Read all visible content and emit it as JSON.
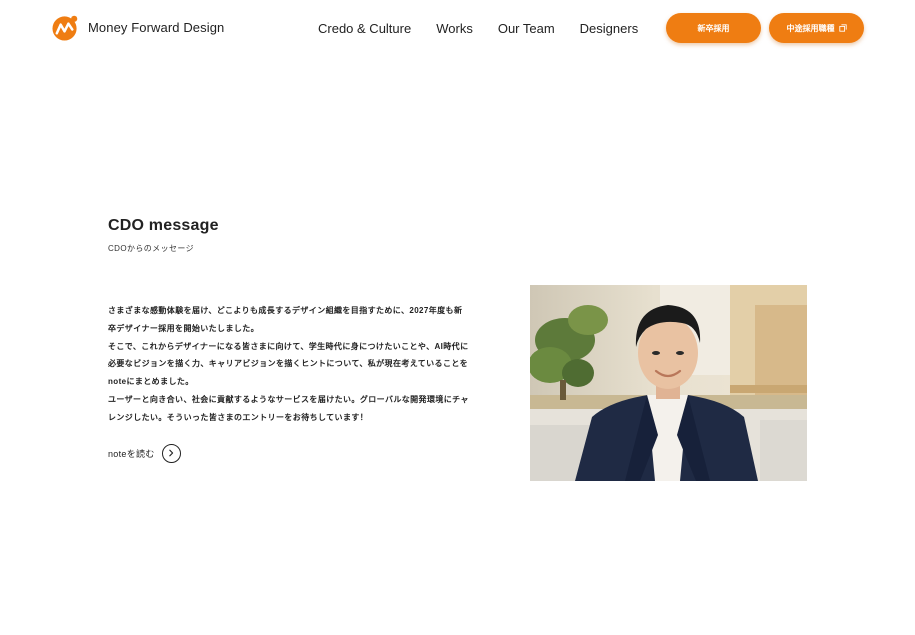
{
  "header": {
    "brand_name": "Money Forward Design",
    "nav": [
      {
        "label": "Credo & Culture"
      },
      {
        "label": "Works"
      },
      {
        "label": "Our Team"
      },
      {
        "label": "Designers"
      }
    ],
    "buttons": {
      "new_grad": "新卒採用",
      "mid_career": "中途採用職種"
    }
  },
  "section": {
    "title": "CDO message",
    "subtitle": "CDOからのメッセージ",
    "body_lines": [
      "さまざまな感動体験を届け、どこよりも成長するデザイン組織を目指すために、2027年度も新",
      "卒デザイナー採用を開始いたしました。",
      "そこで、これからデザイナーになる皆さまに向けて、学生時代に身につけたいことや、AI時代に",
      "必要なビジョンを描く力、キャリアビジョンを描くヒントについて、私が現在考えていることを",
      "noteにまとめました。",
      "ユーザーと向き合い、社会に貢献するようなサービスを届けたい。グローバルな開発環境にチャ",
      "レンジしたい。そういった皆さまのエントリーをお待ちしています！"
    ],
    "read_link": "noteを読む"
  },
  "colors": {
    "accent": "#ef7d12",
    "text": "#1f1f1f",
    "background": "#ffffff"
  },
  "icons": {
    "brand": "money-forward-logo-icon",
    "external": "external-link-icon",
    "arrow": "chevron-right-icon"
  }
}
